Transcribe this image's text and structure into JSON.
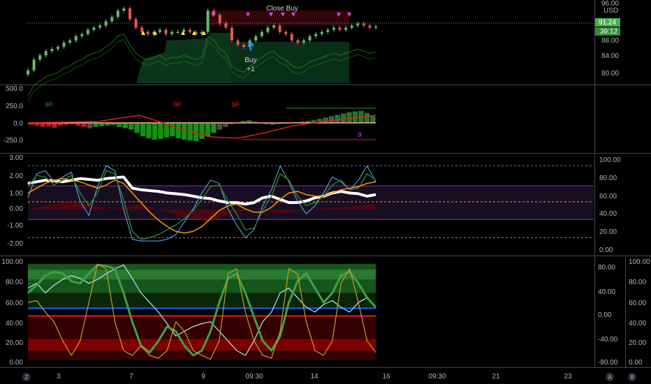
{
  "colors": {
    "background": "#000000",
    "separator": "#434651",
    "axis_text": "#b2b5be",
    "price_tag": "#4caf50",
    "time_tag": "#388e3c",
    "buy": "#2196f3",
    "sell": "#e040fb",
    "green": "#1b9e1b",
    "red": "#e51c23",
    "orange": "#ff9800",
    "white": "#ffffff"
  },
  "price_scale": {
    "currency": "USD",
    "last_price": "91.24",
    "countdown": "39:12"
  },
  "annotations": {
    "close_buy": "Close Buy",
    "buy": "Buy",
    "buy_qty": "+1"
  },
  "badges": {
    "timezone": "Z",
    "auto": "A",
    "bottom_right": "B"
  },
  "time_axis": [
    "3",
    "7",
    "9",
    "09:30",
    "14",
    "16",
    "09:30",
    "21",
    "23"
  ],
  "chart_data": [
    {
      "type": "candlestick",
      "title": "",
      "y_ticks": [
        "96.00",
        "88.00",
        "84.00",
        "80.00"
      ],
      "ylim": [
        78,
        97
      ],
      "close": [
        81,
        83.5,
        84.5,
        85.5,
        86,
        86.5,
        87.5,
        88,
        89,
        89.5,
        90.5,
        91,
        91.5,
        92.5,
        93.5,
        95,
        95.5,
        93,
        91,
        90,
        89.5,
        90,
        90.5,
        89.5,
        90,
        90,
        90.5,
        90,
        89.5,
        90,
        95,
        94,
        92,
        91,
        88,
        87,
        86.5,
        88,
        89,
        90,
        91,
        91.5,
        90,
        89.5,
        88,
        87.5,
        88,
        89,
        89.5,
        90,
        90.5,
        91,
        90.5,
        91,
        91.5,
        92,
        91.5,
        91,
        91.24
      ],
      "markers": {
        "buy_signals": 1,
        "sell_signals": 7,
        "warning_triangles": 5
      }
    },
    {
      "type": "bar",
      "title": "",
      "y_ticks": [
        "500.0",
        "250.0",
        "0.0",
        "-250.0"
      ],
      "ylim": [
        -300,
        420
      ],
      "labels": [
        "9P",
        "9P",
        "9P",
        "9"
      ],
      "values": [
        -30,
        -40,
        -60,
        -50,
        -70,
        -40,
        -30,
        -20,
        -40,
        -60,
        -80,
        -60,
        -50,
        -40,
        -30,
        -60,
        -80,
        -100,
        -150,
        -200,
        -230,
        -250,
        -240,
        -220,
        -200,
        -230,
        -250,
        -260,
        -270,
        -240,
        -200,
        -150,
        -100,
        -60,
        -20,
        10,
        30,
        40,
        20,
        -10,
        -20,
        -30,
        -20,
        -10,
        5,
        10,
        20,
        30,
        40,
        60,
        80,
        100,
        120,
        140,
        160,
        170,
        180,
        150,
        100
      ]
    },
    {
      "type": "line",
      "title": "",
      "y_ticks_left": [
        "3.00",
        "2.00",
        "1.00",
        "0.00",
        "-1.00",
        "-2.00"
      ],
      "y_ticks_right": [
        "100.00",
        "80.00",
        "60.00",
        "40.00",
        "20.00",
        "0.00"
      ],
      "ylim": [
        -2.5,
        3
      ],
      "series": [
        {
          "values": [
            1.4,
            1.5,
            1.6,
            1.55,
            1.5,
            1.6,
            1.7,
            1.65,
            1.6,
            1.7,
            1.75,
            1.8,
            1.1,
            1.0,
            0.95,
            0.9,
            0.8,
            0.75,
            0.7,
            0.6,
            0.5,
            0.45,
            0.3,
            0.2,
            0.2,
            0.1,
            0.2,
            0.5,
            0.6,
            0.4,
            0.2,
            0.2,
            0.3,
            0.5,
            0.6,
            0.8,
            0.9,
            0.8,
            0.75,
            0.6,
            0.7
          ]
        },
        {
          "values": [
            0.5,
            2.0,
            2.2,
            1.5,
            1.8,
            2.1,
            0.3,
            -0.6,
            1.2,
            2.5,
            2.2,
            -0.2,
            -2.1,
            -2.2,
            -2.2,
            -2.2,
            -2.1,
            -1.8,
            -1.0,
            -0.2,
            0.8,
            1.6,
            1.4,
            -0.2,
            -1.2,
            -2.0,
            -1.5,
            0.0,
            1.0,
            2.5,
            1.5,
            0.3,
            -0.5,
            0.0,
            0.8,
            1.8,
            1.5,
            1.0,
            1.6,
            2.5,
            1.5
          ]
        },
        {
          "values": [
            1.2,
            1.9,
            1.8,
            1.3,
            1.6,
            1.9,
            0.8,
            0.0,
            0.8,
            2.2,
            2.0,
            0.4,
            -1.6,
            -2.1,
            -2.0,
            -1.8,
            -1.5,
            -1.2,
            -0.8,
            -0.3,
            0.4,
            1.2,
            1.3,
            0.3,
            -0.5,
            -1.5,
            -1.4,
            -0.3,
            0.6,
            2.0,
            1.6,
            0.6,
            0.0,
            0.2,
            0.6,
            1.3,
            1.6,
            1.0,
            1.1,
            2.0,
            1.6
          ]
        },
        {
          "values": [
            0.8,
            1.1,
            1.4,
            1.6,
            1.7,
            1.6,
            1.5,
            1.3,
            1.1,
            1.3,
            1.6,
            1.4,
            0.8,
            0.2,
            -0.4,
            -0.9,
            -1.3,
            -1.6,
            -1.7,
            -1.6,
            -1.3,
            -0.8,
            -0.3,
            0.0,
            0.1,
            -0.2,
            -0.4,
            -0.4,
            -0.1,
            0.4,
            0.8,
            0.9,
            0.7,
            0.6,
            0.6,
            0.8,
            1.0,
            1.1,
            1.2,
            1.4,
            1.5
          ]
        }
      ]
    },
    {
      "type": "line",
      "title": "",
      "y_ticks_left": [
        "100.00",
        "80.00",
        "60.00",
        "40.00",
        "20.00",
        "0.00"
      ],
      "y_ticks_right_inner": [
        "80.00",
        "40.00",
        "0.00",
        "-40.00",
        "-80.00"
      ],
      "y_ticks_right_outer": [
        "100.00",
        "80.00",
        "60.00",
        "40.00",
        "20.00",
        "0.00"
      ],
      "ylim": [
        -3,
        103
      ],
      "series": [
        {
          "values": [
            75,
            80,
            70,
            78,
            84,
            88,
            85,
            80,
            84,
            90,
            95,
            99,
            85,
            70,
            60,
            50,
            38,
            25,
            30,
            35,
            38,
            40,
            30,
            20,
            10,
            5,
            20,
            40,
            50,
            70,
            75,
            65,
            55,
            50,
            58,
            62,
            55,
            50,
            60,
            65,
            55
          ]
        },
        {
          "values": [
            70,
            78,
            88,
            92,
            90,
            82,
            80,
            90,
            99,
            98,
            95,
            70,
            40,
            15,
            8,
            20,
            35,
            30,
            15,
            5,
            10,
            30,
            60,
            85,
            90,
            70,
            45,
            20,
            10,
            25,
            60,
            82,
            90,
            75,
            60,
            70,
            88,
            92,
            80,
            65,
            55
          ]
        },
        {
          "values": [
            60,
            62,
            50,
            40,
            20,
            5,
            20,
            60,
            100,
            95,
            40,
            10,
            5,
            15,
            5,
            2,
            10,
            40,
            30,
            10,
            5,
            1,
            20,
            90,
            95,
            50,
            20,
            5,
            2,
            30,
            95,
            90,
            40,
            10,
            5,
            20,
            80,
            95,
            60,
            20,
            8
          ]
        }
      ]
    }
  ]
}
